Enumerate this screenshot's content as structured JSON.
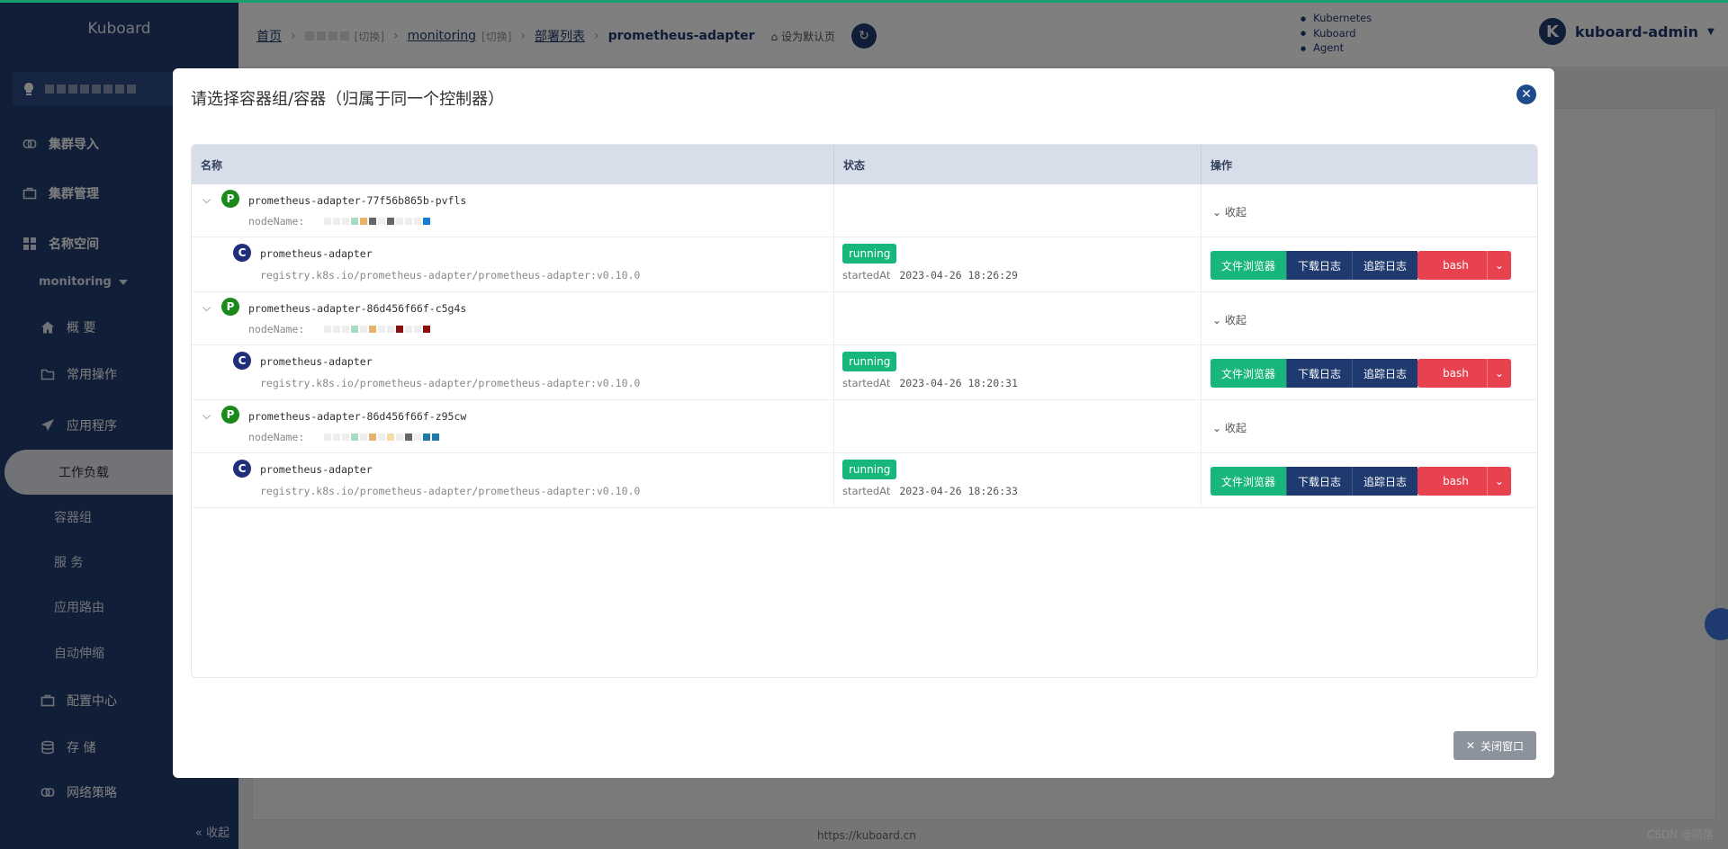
{
  "sidebar": {
    "brand": "Kuboard",
    "items": [
      {
        "label": "集群导入",
        "icon": "link-icon"
      },
      {
        "label": "集群管理",
        "icon": "briefcase-icon"
      },
      {
        "label": "名称空间",
        "icon": "grid-icon"
      }
    ],
    "namespace": "monitoring",
    "ns_items": [
      {
        "label": "概 要",
        "icon": "home-icon"
      },
      {
        "label": "常用操作",
        "icon": "folder-icon"
      },
      {
        "label": "应用程序",
        "icon": "paper-plane-icon"
      }
    ],
    "app_subitems": [
      "工作负载",
      "容器组",
      "服 务",
      "应用路由",
      "自动伸缩"
    ],
    "bottom_items": [
      {
        "label": "配置中心",
        "icon": "briefcase-icon"
      },
      {
        "label": "存 储",
        "icon": "database-icon"
      },
      {
        "label": "网络策略",
        "icon": "link-icon"
      }
    ],
    "collapse_label": "« 收起"
  },
  "header": {
    "crumbs": {
      "home": "首页",
      "switch": "[切换]",
      "ns": "monitoring",
      "ns_switch": "[切换]",
      "list": "部署列表",
      "current": "prometheus-adapter",
      "set_default": "设为默认页"
    },
    "versions": [
      "Kubernetes",
      "Kuboard",
      "Agent"
    ],
    "user": "kuboard-admin",
    "avatar_letter": "K"
  },
  "modal": {
    "title": "请选择容器组/容器（归属于同一个控制器）",
    "columns": [
      "名称",
      "状态",
      "操作"
    ],
    "fold_label": "收起",
    "node_label": "nodeName:",
    "started_label": "startedAt",
    "actions": [
      "文件浏览器",
      "下载日志",
      "追踪日志",
      "bash"
    ],
    "pods": [
      {
        "name": "prometheus-adapter-77f56b865b-pvfls",
        "container": {
          "name": "prometheus-adapter",
          "image": "registry.k8s.io/prometheus-adapter/prometheus-adapter:v0.10.0",
          "status": "running",
          "started_at": "2023-04-26 18:26:29"
        }
      },
      {
        "name": "prometheus-adapter-86d456f66f-c5g4s",
        "container": {
          "name": "prometheus-adapter",
          "image": "registry.k8s.io/prometheus-adapter/prometheus-adapter:v0.10.0",
          "status": "running",
          "started_at": "2023-04-26 18:20:31"
        }
      },
      {
        "name": "prometheus-adapter-86d456f66f-z95cw",
        "container": {
          "name": "prometheus-adapter",
          "image": "registry.k8s.io/prometheus-adapter/prometheus-adapter:v0.10.0",
          "status": "running",
          "started_at": "2023-04-26 18:26:33"
        }
      }
    ],
    "close_window": "关闭窗口"
  },
  "footer": {
    "link": "https://kuboard.cn",
    "watermark": "CSDN @陨落"
  }
}
